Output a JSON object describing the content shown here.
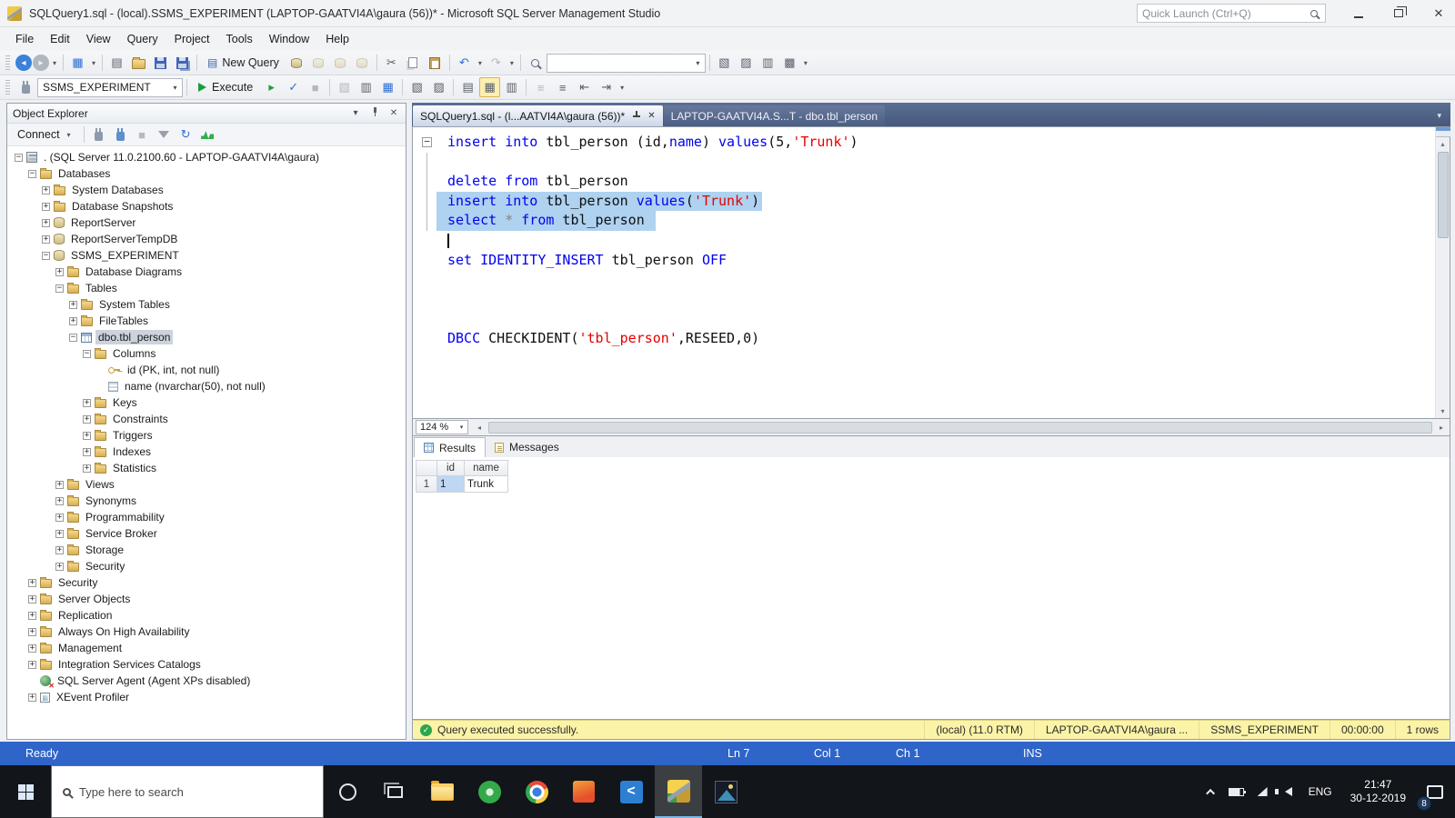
{
  "window": {
    "title": "SQLQuery1.sql - (local).SSMS_EXPERIMENT (LAPTOP-GAATVI4A\\gaura (56))* - Microsoft SQL Server Management Studio",
    "quick_launch_placeholder": "Quick Launch (Ctrl+Q)"
  },
  "menu": {
    "items": [
      "File",
      "Edit",
      "View",
      "Query",
      "Project",
      "Tools",
      "Window",
      "Help"
    ]
  },
  "toolbar1": {
    "items": [
      {
        "t": "icon",
        "n": "nav-back-icon",
        "g": "◂",
        "cls": "round blue"
      },
      {
        "t": "icon",
        "n": "nav-forward-icon",
        "g": "▸",
        "cls": "round gray"
      },
      {
        "t": "caret",
        "n": "nav-history-caret"
      },
      {
        "t": "sep"
      },
      {
        "t": "icon",
        "n": "new-query-flyout-icon",
        "g": "▦",
        "cls": "blue-g"
      },
      {
        "t": "caret",
        "n": "new-query-flyout-caret"
      },
      {
        "t": "sep"
      },
      {
        "t": "icon",
        "n": "new-file-icon",
        "g": "▤"
      },
      {
        "t": "icon",
        "n": "open-file-icon",
        "cls": "ic-folderS"
      },
      {
        "t": "icon",
        "n": "save-icon",
        "cls": "ic-save"
      },
      {
        "t": "icon",
        "n": "save-all-icon",
        "cls": "ic-save all"
      },
      {
        "t": "sep"
      },
      {
        "t": "btn",
        "n": "new-query-button",
        "label": "New Query",
        "g": "▤"
      },
      {
        "t": "icon",
        "n": "database-engine-query-icon",
        "cls": "ic-dbq"
      },
      {
        "t": "icon",
        "n": "mdx-query-icon",
        "cls": "ic-dbq dim"
      },
      {
        "t": "icon",
        "n": "dmx-query-icon",
        "cls": "ic-dbq dim"
      },
      {
        "t": "icon",
        "n": "xmla-query-icon",
        "cls": "ic-dbq dim"
      },
      {
        "t": "sep"
      },
      {
        "t": "icon",
        "n": "cut-icon",
        "g": "✂"
      },
      {
        "t": "icon",
        "n": "copy-icon",
        "cls": "ic-copy"
      },
      {
        "t": "icon",
        "n": "paste-icon",
        "cls": "ic-paste"
      },
      {
        "t": "sep"
      },
      {
        "t": "icon",
        "n": "undo-icon",
        "g": "↶",
        "cls": "blue-g"
      },
      {
        "t": "caret",
        "n": "undo-history-caret"
      },
      {
        "t": "icon",
        "n": "redo-icon",
        "g": "↷",
        "cls": "dim"
      },
      {
        "t": "caret",
        "n": "redo-history-caret"
      },
      {
        "t": "sep"
      },
      {
        "t": "icon",
        "n": "find-icon",
        "cls": "ic-mag"
      },
      {
        "t": "combo",
        "n": "find-combo",
        "value": "",
        "w": 175
      },
      {
        "t": "sep"
      },
      {
        "t": "icon",
        "n": "solution-explorer-icon",
        "g": "▧"
      },
      {
        "t": "icon",
        "n": "properties-window-icon",
        "g": "▨"
      },
      {
        "t": "icon",
        "n": "object-explorer-toggle-icon",
        "g": "▥"
      },
      {
        "t": "icon",
        "n": "template-explorer-icon",
        "g": "▩"
      },
      {
        "t": "caret",
        "n": "toolbar-options-caret"
      }
    ]
  },
  "toolbar2": {
    "items": [
      {
        "t": "icon",
        "n": "change-connection-icon",
        "cls": "ic-plug"
      },
      {
        "t": "combo",
        "n": "available-databases-combo",
        "value": "SSMS_EXPERIMENT",
        "w": 160
      },
      {
        "t": "sep"
      },
      {
        "t": "btn-exec",
        "n": "execute-button",
        "label": "Execute"
      },
      {
        "t": "icon",
        "n": "debug-icon",
        "g": "▸",
        "cls": "green-g"
      },
      {
        "t": "icon",
        "n": "parse-icon",
        "g": "✓",
        "cls": "blue-g"
      },
      {
        "t": "icon",
        "n": "cancel-query-icon",
        "g": "■",
        "cls": "dim"
      },
      {
        "t": "sep"
      },
      {
        "t": "icon",
        "n": "estimated-plan-icon",
        "g": "▧",
        "cls": "dim"
      },
      {
        "t": "icon",
        "n": "query-options-icon",
        "g": "▥"
      },
      {
        "t": "icon",
        "n": "intellisense-icon",
        "g": "▦",
        "cls": "blue-g"
      },
      {
        "t": "sep"
      },
      {
        "t": "icon",
        "n": "actual-plan-icon",
        "g": "▧"
      },
      {
        "t": "icon",
        "n": "client-statistics-icon",
        "g": "▨"
      },
      {
        "t": "sep"
      },
      {
        "t": "icon",
        "n": "results-to-text-icon",
        "g": "▤"
      },
      {
        "t": "icon",
        "n": "results-to-grid-icon",
        "g": "▦",
        "cls": "sel-ic"
      },
      {
        "t": "icon",
        "n": "results-to-file-icon",
        "g": "▥"
      },
      {
        "t": "sep"
      },
      {
        "t": "icon",
        "n": "comment-icon",
        "g": "≡",
        "cls": "dim"
      },
      {
        "t": "icon",
        "n": "uncomment-icon",
        "g": "≡"
      },
      {
        "t": "icon",
        "n": "indent-decrease-icon",
        "g": "⇤"
      },
      {
        "t": "icon",
        "n": "indent-increase-icon",
        "g": "⇥"
      },
      {
        "t": "caret",
        "n": "toolbar2-options-caret"
      }
    ]
  },
  "object_explorer": {
    "title": "Object Explorer",
    "toolbar": {
      "items": [
        {
          "t": "btn",
          "n": "connect-button",
          "label": "Connect",
          "caret": true
        },
        {
          "t": "sep"
        },
        {
          "t": "icon",
          "n": "disconnect-icon",
          "cls": "ic-plug"
        },
        {
          "t": "icon",
          "n": "new-connection-icon",
          "cls": "ic-plug p2"
        },
        {
          "t": "icon",
          "n": "stop-icon",
          "g": "■",
          "cls": "dim"
        },
        {
          "t": "icon",
          "n": "filter-icon",
          "cls": "ic-funnel"
        },
        {
          "t": "icon",
          "n": "refresh-icon",
          "g": "↻",
          "cls": "blue-g"
        },
        {
          "t": "icon",
          "n": "activity-monitor-icon",
          "cls": "ic-pulse"
        }
      ]
    },
    "tree": [
      {
        "level": 0,
        "tw": "minus",
        "icon": "server",
        "label": ". (SQL Server 11.0.2100.60 - LAPTOP-GAATVI4A\\gaura)"
      },
      {
        "level": 1,
        "tw": "minus",
        "icon": "folder",
        "label": "Databases"
      },
      {
        "level": 2,
        "tw": "plus",
        "icon": "folder",
        "label": "System Databases"
      },
      {
        "level": 2,
        "tw": "plus",
        "icon": "folder",
        "label": "Database Snapshots"
      },
      {
        "level": 2,
        "tw": "plus",
        "icon": "db",
        "label": "ReportServer"
      },
      {
        "level": 2,
        "tw": "plus",
        "icon": "db",
        "label": "ReportServerTempDB"
      },
      {
        "level": 2,
        "tw": "minus",
        "icon": "db",
        "label": "SSMS_EXPERIMENT"
      },
      {
        "level": 3,
        "tw": "plus",
        "icon": "folder",
        "label": "Database Diagrams"
      },
      {
        "level": 3,
        "tw": "minus",
        "icon": "folder",
        "label": "Tables"
      },
      {
        "level": 4,
        "tw": "plus",
        "icon": "folder",
        "label": "System Tables"
      },
      {
        "level": 4,
        "tw": "plus",
        "icon": "folder",
        "label": "FileTables"
      },
      {
        "level": 4,
        "tw": "minus",
        "icon": "table",
        "label": "dbo.tbl_person",
        "selected": true
      },
      {
        "level": 5,
        "tw": "minus",
        "icon": "folder",
        "label": "Columns"
      },
      {
        "level": 6,
        "tw": null,
        "icon": "key",
        "label": "id (PK, int, not null)"
      },
      {
        "level": 6,
        "tw": null,
        "icon": "col",
        "label": "name (nvarchar(50), not null)"
      },
      {
        "level": 5,
        "tw": "plus",
        "icon": "folder",
        "label": "Keys"
      },
      {
        "level": 5,
        "tw": "plus",
        "icon": "folder",
        "label": "Constraints"
      },
      {
        "level": 5,
        "tw": "plus",
        "icon": "folder",
        "label": "Triggers"
      },
      {
        "level": 5,
        "tw": "plus",
        "icon": "folder",
        "label": "Indexes"
      },
      {
        "level": 5,
        "tw": "plus",
        "icon": "folder",
        "label": "Statistics"
      },
      {
        "level": 3,
        "tw": "plus",
        "icon": "folder",
        "label": "Views"
      },
      {
        "level": 3,
        "tw": "plus",
        "icon": "folder",
        "label": "Synonyms"
      },
      {
        "level": 3,
        "tw": "plus",
        "icon": "folder",
        "label": "Programmability"
      },
      {
        "level": 3,
        "tw": "plus",
        "icon": "folder",
        "label": "Service Broker"
      },
      {
        "level": 3,
        "tw": "plus",
        "icon": "folder",
        "label": "Storage"
      },
      {
        "level": 3,
        "tw": "plus",
        "icon": "folder",
        "label": "Security"
      },
      {
        "level": 1,
        "tw": "plus",
        "icon": "folder",
        "label": "Security"
      },
      {
        "level": 1,
        "tw": "plus",
        "icon": "folder",
        "label": "Server Objects"
      },
      {
        "level": 1,
        "tw": "plus",
        "icon": "folder",
        "label": "Replication"
      },
      {
        "level": 1,
        "tw": "plus",
        "icon": "folder",
        "label": "Always On High Availability"
      },
      {
        "level": 1,
        "tw": "plus",
        "icon": "folder",
        "label": "Management"
      },
      {
        "level": 1,
        "tw": "plus",
        "icon": "folder",
        "label": "Integration Services Catalogs"
      },
      {
        "level": 1,
        "tw": null,
        "icon": "agent",
        "label": "SQL Server Agent (Agent XPs disabled)"
      },
      {
        "level": 1,
        "tw": "plus",
        "icon": "xevent",
        "label": "XEvent Profiler"
      }
    ]
  },
  "editor": {
    "tabs": [
      {
        "label": "SQLQuery1.sql - (l...AATVI4A\\gaura (56))*",
        "active": true
      },
      {
        "label": "LAPTOP-GAATVI4A.S...T - dbo.tbl_person",
        "active": false
      }
    ],
    "zoom": "124 %",
    "lines": [
      {
        "fold": "minus",
        "tokens": [
          {
            "c": "k",
            "t": "insert"
          },
          {
            "c": "p",
            "t": " "
          },
          {
            "c": "k",
            "t": "into"
          },
          {
            "c": "p",
            "t": " tbl_person (id,"
          },
          {
            "c": "k",
            "t": "name"
          },
          {
            "c": "p",
            "t": ") "
          },
          {
            "c": "k",
            "t": "values"
          },
          {
            "c": "p",
            "t": "(5,"
          },
          {
            "c": "s",
            "t": "'Trunk'"
          },
          {
            "c": "p",
            "t": ")"
          }
        ]
      },
      {
        "gl": true,
        "tokens": []
      },
      {
        "gl": true,
        "tokens": [
          {
            "c": "k",
            "t": "delete"
          },
          {
            "c": "p",
            "t": " "
          },
          {
            "c": "k",
            "t": "from"
          },
          {
            "c": "p",
            "t": " tbl_person"
          }
        ]
      },
      {
        "gl": true,
        "sel": true,
        "tokens": [
          {
            "c": "k",
            "t": "insert"
          },
          {
            "c": "p",
            "t": " "
          },
          {
            "c": "k",
            "t": "into"
          },
          {
            "c": "p",
            "t": " tbl_person "
          },
          {
            "c": "k",
            "t": "values"
          },
          {
            "c": "p",
            "t": "("
          },
          {
            "c": "s",
            "t": "'Trunk'"
          },
          {
            "c": "p",
            "t": ")"
          }
        ]
      },
      {
        "gl": true,
        "sel": true,
        "tokens": [
          {
            "c": "k",
            "t": "select"
          },
          {
            "c": "p",
            "t": " "
          },
          {
            "c": "o",
            "t": "*"
          },
          {
            "c": "p",
            "t": " "
          },
          {
            "c": "k",
            "t": "from"
          },
          {
            "c": "p",
            "t": " tbl_person "
          }
        ]
      },
      {
        "caret": true,
        "tokens": []
      },
      {
        "tokens": [
          {
            "c": "k",
            "t": "set"
          },
          {
            "c": "p",
            "t": " "
          },
          {
            "c": "k",
            "t": "IDENTITY_INSERT"
          },
          {
            "c": "p",
            "t": " tbl_person "
          },
          {
            "c": "k",
            "t": "OFF"
          }
        ]
      },
      {
        "tokens": []
      },
      {
        "tokens": []
      },
      {
        "tokens": []
      },
      {
        "tokens": [
          {
            "c": "k",
            "t": "DBCC"
          },
          {
            "c": "p",
            "t": " CHECKIDENT("
          },
          {
            "c": "s",
            "t": "'tbl_person'"
          },
          {
            "c": "p",
            "t": ",RESEED,0)"
          }
        ]
      }
    ]
  },
  "results": {
    "tabs": [
      {
        "label": "Results",
        "active": true,
        "icon": "ric-grid"
      },
      {
        "label": "Messages",
        "active": false,
        "icon": "ric-msg"
      }
    ],
    "grid": {
      "columns": [
        "id",
        "name"
      ],
      "rows": [
        {
          "n": "1",
          "cells": [
            "1",
            "Trunk"
          ],
          "sel": 0
        }
      ]
    }
  },
  "exec_status": {
    "message": "Query executed successfully.",
    "segments": [
      "(local) (11.0 RTM)",
      "LAPTOP-GAATVI4A\\gaura ...",
      "SSMS_EXPERIMENT",
      "00:00:00",
      "1 rows"
    ]
  },
  "status_bar": {
    "ready": "Ready",
    "ln": "Ln 7",
    "col": "Col 1",
    "ch": "Ch 1",
    "mode": "INS"
  },
  "taskbar": {
    "search_placeholder": "Type here to search",
    "apps": [
      {
        "name": "cortana-icon",
        "cls": "ic-cortana"
      },
      {
        "name": "task-view-icon",
        "cls": "ic-taskview"
      },
      {
        "name": "file-explorer-icon",
        "cls": "ic-fe"
      },
      {
        "name": "green-app-icon",
        "cls": "ic-greenapp"
      },
      {
        "name": "chrome-icon",
        "cls": "ic-chrome"
      },
      {
        "name": "orange-app-icon",
        "cls": "ic-orangeapp"
      },
      {
        "name": "vscode-icon",
        "cls": "ic-vscode",
        "g": "<"
      },
      {
        "name": "ssms-icon",
        "cls": "ic-ssms",
        "active": true
      },
      {
        "name": "photos-icon",
        "cls": "ic-photos"
      }
    ],
    "tray": [
      {
        "name": "tray-expand-icon",
        "cls": "ic-caretup"
      },
      {
        "name": "battery-icon",
        "cls": "ic-batt"
      },
      {
        "name": "network-icon",
        "cls": "ic-net"
      },
      {
        "name": "volume-icon",
        "cls": "ic-vol"
      }
    ],
    "lang": "ENG",
    "time": "21:47",
    "date": "30-12-2019",
    "notification_count": "8"
  }
}
